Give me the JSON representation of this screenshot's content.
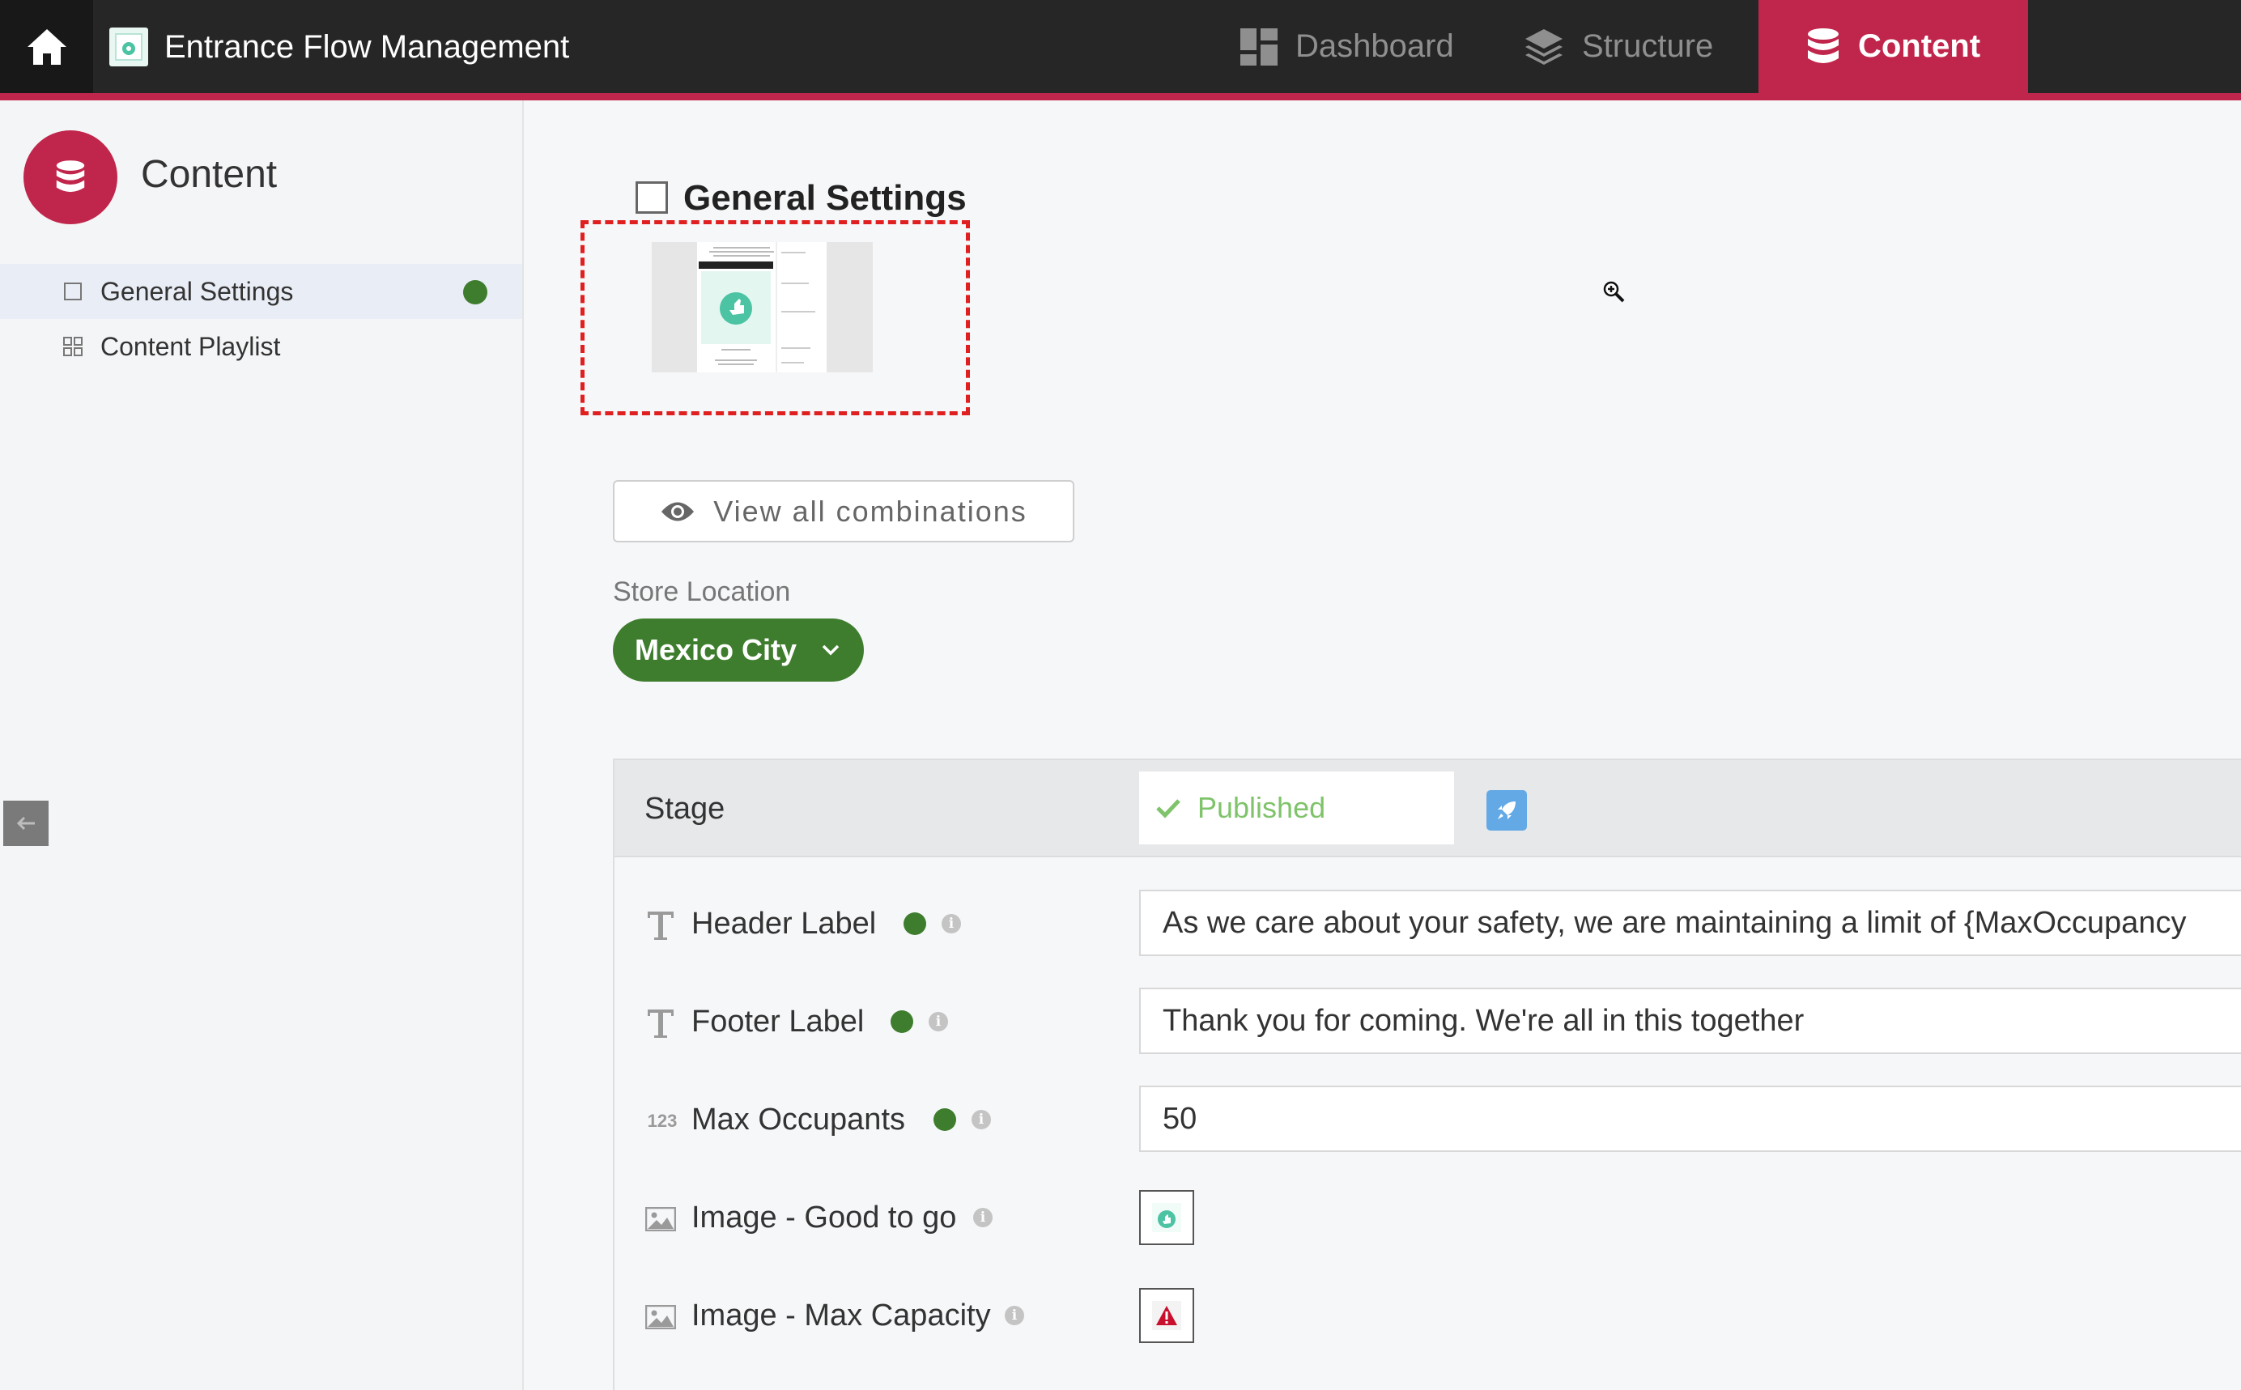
{
  "header": {
    "app_title": "Entrance Flow Management",
    "nav": {
      "dashboard": "Dashboard",
      "structure": "Structure",
      "content": "Content"
    },
    "accent_color": "#c0264b"
  },
  "sidebar": {
    "title": "Content",
    "items": [
      {
        "label": "General Settings",
        "active": true,
        "status_dot": "#3f7d2e"
      },
      {
        "label": "Content Playlist",
        "active": false
      }
    ]
  },
  "main": {
    "section_title": "General Settings",
    "view_all_label": "View all combinations",
    "store_location": {
      "label": "Store Location",
      "value": "Mexico City"
    },
    "stage": {
      "label": "Stage",
      "status": "Published"
    },
    "fields": [
      {
        "type": "text",
        "type_icon": "T",
        "label": "Header Label",
        "has_dot": true,
        "value": "As we care about your safety, we are maintaining a limit of {MaxOccupancy"
      },
      {
        "type": "text",
        "type_icon": "T",
        "label": "Footer Label",
        "has_dot": true,
        "value": "Thank you for coming. We're all in this together"
      },
      {
        "type": "number",
        "type_icon": "123",
        "label": "Max Occupants",
        "has_dot": true,
        "value": "50"
      },
      {
        "type": "image",
        "label": "Image - Good to go",
        "has_dot": false,
        "thumb_icon": "thumbs-up-icon"
      },
      {
        "type": "image",
        "label": "Image - Max Capacity",
        "has_dot": false,
        "thumb_icon": "warning-icon"
      }
    ]
  }
}
